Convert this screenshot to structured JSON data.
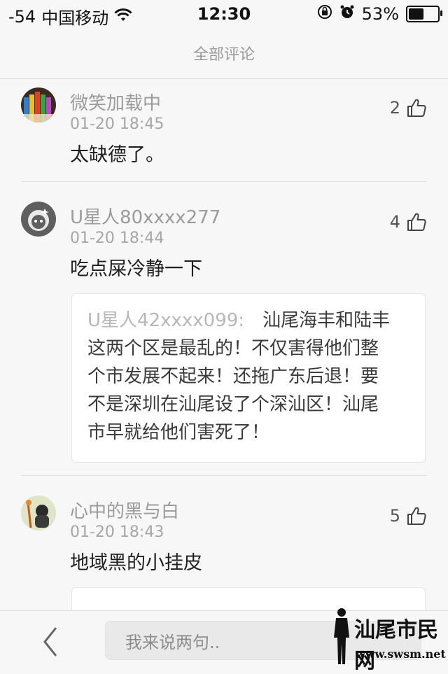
{
  "status_bar": {
    "signal": "-54",
    "carrier": "中国移动",
    "time": "12:30",
    "battery_percent": "53%",
    "battery_level": 0.53
  },
  "header": {
    "title": "全部评论"
  },
  "comments": [
    {
      "username": "微笑加载中",
      "timestamp": "01-20 18:45",
      "text": "太缺德了。",
      "likes": "2"
    },
    {
      "username": "U星人80xxxx277",
      "timestamp": "01-20 18:44",
      "text": "吃点屎冷静一下",
      "likes": "4",
      "quote": {
        "author": "U星人42xxxx099:",
        "line1": "汕尾海丰和陆丰",
        "line2": "这两个区是最乱的！不仅害得他们整",
        "line3": "个市发展不起来！还拖广东后退！要",
        "line4": "不是深圳在汕尾设了个深汕区！汕尾",
        "line5": "市早就给他们害死了！"
      }
    },
    {
      "username": "心中的黑与白",
      "timestamp": "01-20 18:43",
      "text": "地域黑的小挂皮",
      "likes": "5"
    }
  ],
  "composer": {
    "placeholder": "我来说两句.."
  },
  "watermark": {
    "text": "汕尾市民网",
    "url": "www.swsm.net"
  }
}
